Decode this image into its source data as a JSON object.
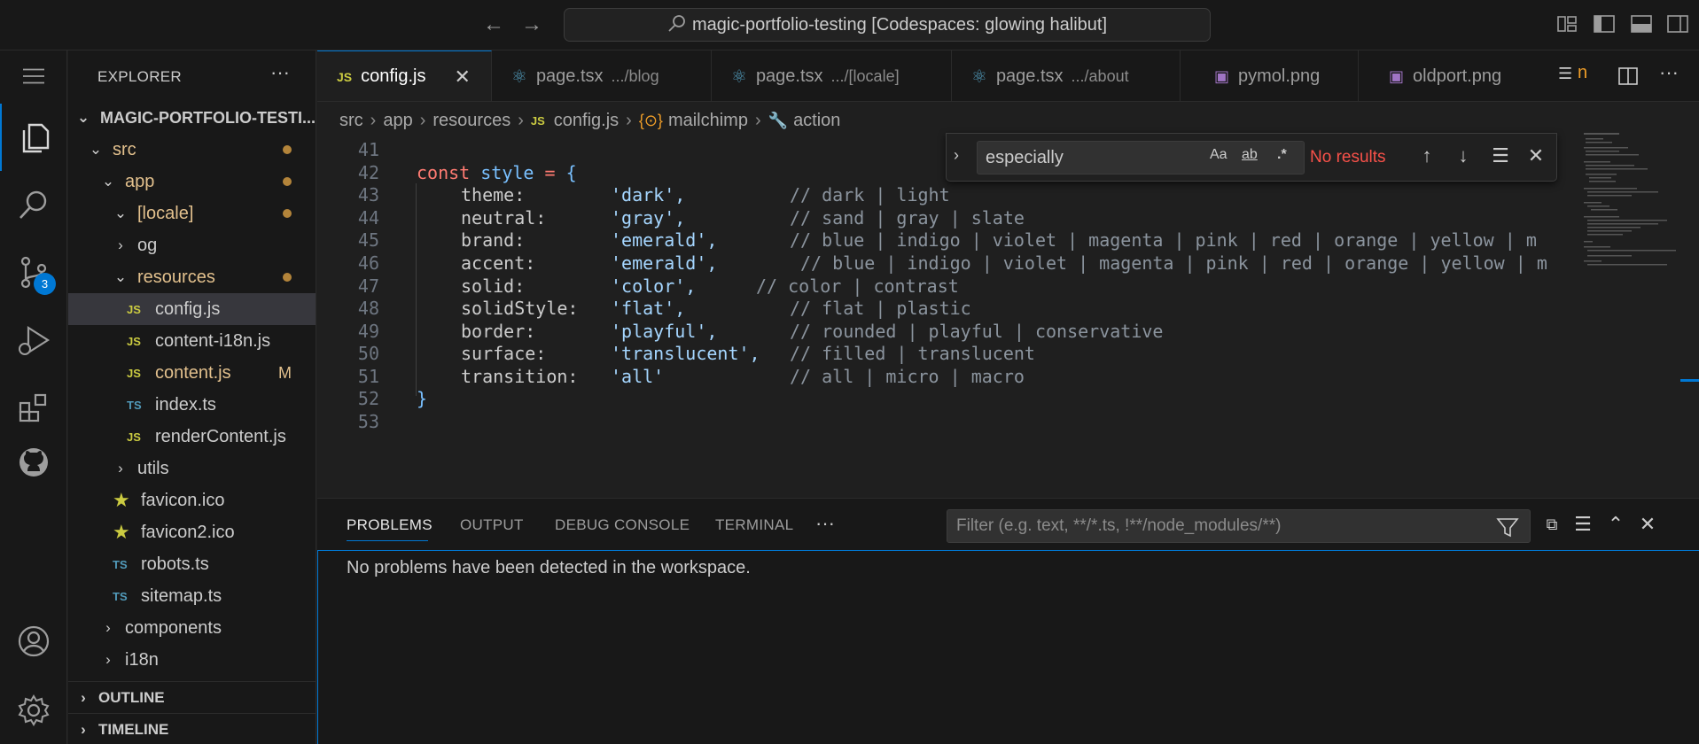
{
  "titlebar": {
    "command_center": "magic-portfolio-testing [Codespaces: glowing halibut]"
  },
  "activity": {
    "scm_badge": "3"
  },
  "explorer": {
    "title": "EXPLORER",
    "more": "···",
    "root": "MAGIC-PORTFOLIO-TESTI...",
    "items": [
      {
        "label": "src",
        "icon": ""
      },
      {
        "label": "app",
        "icon": ""
      },
      {
        "label": "[locale]",
        "icon": ""
      },
      {
        "label": "og",
        "icon": ""
      },
      {
        "label": "resources",
        "icon": ""
      },
      {
        "label": "config.js",
        "icon": "JS"
      },
      {
        "label": "content-i18n.js",
        "icon": "JS"
      },
      {
        "label": "content.js",
        "icon": "JS",
        "badge": "M"
      },
      {
        "label": "index.ts",
        "icon": "TS"
      },
      {
        "label": "renderContent.js",
        "icon": "JS"
      },
      {
        "label": "utils",
        "icon": ""
      },
      {
        "label": "favicon.ico",
        "icon": "★"
      },
      {
        "label": "favicon2.ico",
        "icon": "★"
      },
      {
        "label": "robots.ts",
        "icon": "TS"
      },
      {
        "label": "sitemap.ts",
        "icon": "TS"
      },
      {
        "label": "components",
        "icon": ""
      },
      {
        "label": "i18n",
        "icon": ""
      }
    ],
    "outline": "OUTLINE",
    "timeline": "TIMELINE"
  },
  "tabs": [
    {
      "icon": "JS",
      "label": "config.js",
      "desc": ""
    },
    {
      "icon": "⚛",
      "label": "page.tsx",
      "desc": ".../blog"
    },
    {
      "icon": "⚛",
      "label": "page.tsx",
      "desc": ".../[locale]"
    },
    {
      "icon": "⚛",
      "label": "page.tsx",
      "desc": ".../about"
    },
    {
      "icon": "▣",
      "label": "pymol.png",
      "desc": ""
    },
    {
      "icon": "▣",
      "label": "oldport.png",
      "desc": ""
    }
  ],
  "tab_overflow": "n",
  "breadcrumbs": [
    "src",
    "app",
    "resources",
    "config.js",
    "mailchimp",
    "action"
  ],
  "breadcrumb_icons": {
    "js": "JS",
    "obj": "{⊙}",
    "fn": "🔧"
  },
  "editor": {
    "lines": [
      {
        "n": "41"
      },
      {
        "n": "42",
        "kw": "const",
        "id": "style",
        "op": " = ",
        "br": "{"
      },
      {
        "n": "43",
        "key": "theme:",
        "val": "'dark',",
        "comment": "// dark | light"
      },
      {
        "n": "44",
        "key": "neutral:",
        "val": "'gray',",
        "comment": "// sand | gray | slate"
      },
      {
        "n": "45",
        "key": "brand:",
        "val": "'emerald',",
        "comment": "// blue | indigo | violet | magenta | pink | red | orange | yellow | m"
      },
      {
        "n": "46",
        "key": "accent:",
        "val": "'emerald',",
        "comment": "// blue | indigo | violet | magenta | pink | red | orange | yellow | m"
      },
      {
        "n": "47",
        "key": "solid:",
        "val": "'color',",
        "comment": "// color | contrast"
      },
      {
        "n": "48",
        "key": "solidStyle:",
        "val": "'flat',",
        "comment": "// flat | plastic"
      },
      {
        "n": "49",
        "key": "border:",
        "val": "'playful',",
        "comment": "// rounded | playful | conservative"
      },
      {
        "n": "50",
        "key": "surface:",
        "val": "'translucent',",
        "comment": "// filled | translucent"
      },
      {
        "n": "51",
        "key": "transition:",
        "val": "'all'",
        "comment": "// all | micro | macro"
      },
      {
        "n": "52",
        "br": "}"
      },
      {
        "n": "53"
      }
    ]
  },
  "find": {
    "query": "especially",
    "case": "Aa",
    "word": "ab",
    "regex": ".*",
    "status": "No results"
  },
  "panel": {
    "tabs": [
      "PROBLEMS",
      "OUTPUT",
      "DEBUG CONSOLE",
      "TERMINAL"
    ],
    "more": "···",
    "filter_placeholder": "Filter (e.g. text, **/*.ts, !**/node_modules/**)",
    "message": "No problems have been detected in the workspace."
  },
  "colors": {
    "accent": "#0078d4",
    "keyword": "#ff7b72",
    "identifier": "#79c0ff",
    "string": "#a5d6ff",
    "comment": "#8b949e",
    "error": "#f85149"
  }
}
